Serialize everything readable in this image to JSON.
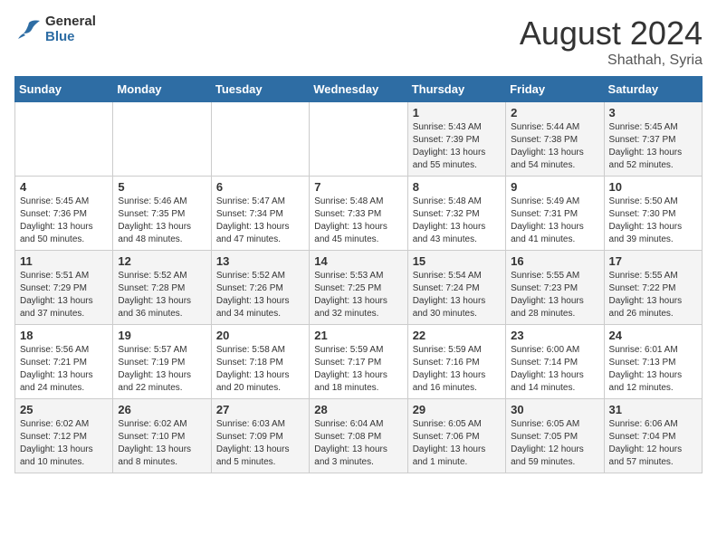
{
  "header": {
    "logo_general": "General",
    "logo_blue": "Blue",
    "month_year": "August 2024",
    "location": "Shathah, Syria"
  },
  "weekdays": [
    "Sunday",
    "Monday",
    "Tuesday",
    "Wednesday",
    "Thursday",
    "Friday",
    "Saturday"
  ],
  "weeks": [
    [
      {
        "day": "",
        "sunrise": "",
        "sunset": "",
        "daylight": ""
      },
      {
        "day": "",
        "sunrise": "",
        "sunset": "",
        "daylight": ""
      },
      {
        "day": "",
        "sunrise": "",
        "sunset": "",
        "daylight": ""
      },
      {
        "day": "",
        "sunrise": "",
        "sunset": "",
        "daylight": ""
      },
      {
        "day": "1",
        "sunrise": "Sunrise: 5:43 AM",
        "sunset": "Sunset: 7:39 PM",
        "daylight": "Daylight: 13 hours and 55 minutes."
      },
      {
        "day": "2",
        "sunrise": "Sunrise: 5:44 AM",
        "sunset": "Sunset: 7:38 PM",
        "daylight": "Daylight: 13 hours and 54 minutes."
      },
      {
        "day": "3",
        "sunrise": "Sunrise: 5:45 AM",
        "sunset": "Sunset: 7:37 PM",
        "daylight": "Daylight: 13 hours and 52 minutes."
      }
    ],
    [
      {
        "day": "4",
        "sunrise": "Sunrise: 5:45 AM",
        "sunset": "Sunset: 7:36 PM",
        "daylight": "Daylight: 13 hours and 50 minutes."
      },
      {
        "day": "5",
        "sunrise": "Sunrise: 5:46 AM",
        "sunset": "Sunset: 7:35 PM",
        "daylight": "Daylight: 13 hours and 48 minutes."
      },
      {
        "day": "6",
        "sunrise": "Sunrise: 5:47 AM",
        "sunset": "Sunset: 7:34 PM",
        "daylight": "Daylight: 13 hours and 47 minutes."
      },
      {
        "day": "7",
        "sunrise": "Sunrise: 5:48 AM",
        "sunset": "Sunset: 7:33 PM",
        "daylight": "Daylight: 13 hours and 45 minutes."
      },
      {
        "day": "8",
        "sunrise": "Sunrise: 5:48 AM",
        "sunset": "Sunset: 7:32 PM",
        "daylight": "Daylight: 13 hours and 43 minutes."
      },
      {
        "day": "9",
        "sunrise": "Sunrise: 5:49 AM",
        "sunset": "Sunset: 7:31 PM",
        "daylight": "Daylight: 13 hours and 41 minutes."
      },
      {
        "day": "10",
        "sunrise": "Sunrise: 5:50 AM",
        "sunset": "Sunset: 7:30 PM",
        "daylight": "Daylight: 13 hours and 39 minutes."
      }
    ],
    [
      {
        "day": "11",
        "sunrise": "Sunrise: 5:51 AM",
        "sunset": "Sunset: 7:29 PM",
        "daylight": "Daylight: 13 hours and 37 minutes."
      },
      {
        "day": "12",
        "sunrise": "Sunrise: 5:52 AM",
        "sunset": "Sunset: 7:28 PM",
        "daylight": "Daylight: 13 hours and 36 minutes."
      },
      {
        "day": "13",
        "sunrise": "Sunrise: 5:52 AM",
        "sunset": "Sunset: 7:26 PM",
        "daylight": "Daylight: 13 hours and 34 minutes."
      },
      {
        "day": "14",
        "sunrise": "Sunrise: 5:53 AM",
        "sunset": "Sunset: 7:25 PM",
        "daylight": "Daylight: 13 hours and 32 minutes."
      },
      {
        "day": "15",
        "sunrise": "Sunrise: 5:54 AM",
        "sunset": "Sunset: 7:24 PM",
        "daylight": "Daylight: 13 hours and 30 minutes."
      },
      {
        "day": "16",
        "sunrise": "Sunrise: 5:55 AM",
        "sunset": "Sunset: 7:23 PM",
        "daylight": "Daylight: 13 hours and 28 minutes."
      },
      {
        "day": "17",
        "sunrise": "Sunrise: 5:55 AM",
        "sunset": "Sunset: 7:22 PM",
        "daylight": "Daylight: 13 hours and 26 minutes."
      }
    ],
    [
      {
        "day": "18",
        "sunrise": "Sunrise: 5:56 AM",
        "sunset": "Sunset: 7:21 PM",
        "daylight": "Daylight: 13 hours and 24 minutes."
      },
      {
        "day": "19",
        "sunrise": "Sunrise: 5:57 AM",
        "sunset": "Sunset: 7:19 PM",
        "daylight": "Daylight: 13 hours and 22 minutes."
      },
      {
        "day": "20",
        "sunrise": "Sunrise: 5:58 AM",
        "sunset": "Sunset: 7:18 PM",
        "daylight": "Daylight: 13 hours and 20 minutes."
      },
      {
        "day": "21",
        "sunrise": "Sunrise: 5:59 AM",
        "sunset": "Sunset: 7:17 PM",
        "daylight": "Daylight: 13 hours and 18 minutes."
      },
      {
        "day": "22",
        "sunrise": "Sunrise: 5:59 AM",
        "sunset": "Sunset: 7:16 PM",
        "daylight": "Daylight: 13 hours and 16 minutes."
      },
      {
        "day": "23",
        "sunrise": "Sunrise: 6:00 AM",
        "sunset": "Sunset: 7:14 PM",
        "daylight": "Daylight: 13 hours and 14 minutes."
      },
      {
        "day": "24",
        "sunrise": "Sunrise: 6:01 AM",
        "sunset": "Sunset: 7:13 PM",
        "daylight": "Daylight: 13 hours and 12 minutes."
      }
    ],
    [
      {
        "day": "25",
        "sunrise": "Sunrise: 6:02 AM",
        "sunset": "Sunset: 7:12 PM",
        "daylight": "Daylight: 13 hours and 10 minutes."
      },
      {
        "day": "26",
        "sunrise": "Sunrise: 6:02 AM",
        "sunset": "Sunset: 7:10 PM",
        "daylight": "Daylight: 13 hours and 8 minutes."
      },
      {
        "day": "27",
        "sunrise": "Sunrise: 6:03 AM",
        "sunset": "Sunset: 7:09 PM",
        "daylight": "Daylight: 13 hours and 5 minutes."
      },
      {
        "day": "28",
        "sunrise": "Sunrise: 6:04 AM",
        "sunset": "Sunset: 7:08 PM",
        "daylight": "Daylight: 13 hours and 3 minutes."
      },
      {
        "day": "29",
        "sunrise": "Sunrise: 6:05 AM",
        "sunset": "Sunset: 7:06 PM",
        "daylight": "Daylight: 13 hours and 1 minute."
      },
      {
        "day": "30",
        "sunrise": "Sunrise: 6:05 AM",
        "sunset": "Sunset: 7:05 PM",
        "daylight": "Daylight: 12 hours and 59 minutes."
      },
      {
        "day": "31",
        "sunrise": "Sunrise: 6:06 AM",
        "sunset": "Sunset: 7:04 PM",
        "daylight": "Daylight: 12 hours and 57 minutes."
      }
    ]
  ]
}
